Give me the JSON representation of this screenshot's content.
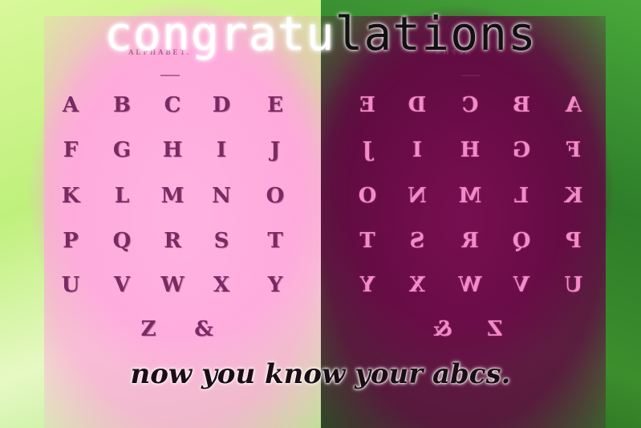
{
  "title": {
    "light": "congratu",
    "dark": "lations"
  },
  "tagline": "now you know your abcs.",
  "page_header_left": "ALPHABET.",
  "page_header_right": "ALPHA",
  "letters_left": [
    "A",
    "B",
    "C",
    "D",
    "E",
    "F",
    "G",
    "H",
    "I",
    "J",
    "K",
    "L",
    "M",
    "N",
    "O",
    "P",
    "Q",
    "R",
    "S",
    "T",
    "U",
    "V",
    "W",
    "X",
    "Y",
    "Z",
    "&"
  ],
  "letters_right": [
    "E",
    "D",
    "C",
    "B",
    "A",
    "J",
    "I",
    "H",
    "G",
    "F",
    "O",
    "N",
    "M",
    "L",
    "K",
    "T",
    "S",
    "R",
    "Q",
    "P",
    "Y",
    "X",
    "W",
    "V",
    "U",
    "&",
    "Z"
  ],
  "colors": {
    "pink": "#ffb2e2",
    "magenta_dark": "#6a0a46",
    "green": "#a8ee6e",
    "dark_green": "#2e7d2a"
  }
}
